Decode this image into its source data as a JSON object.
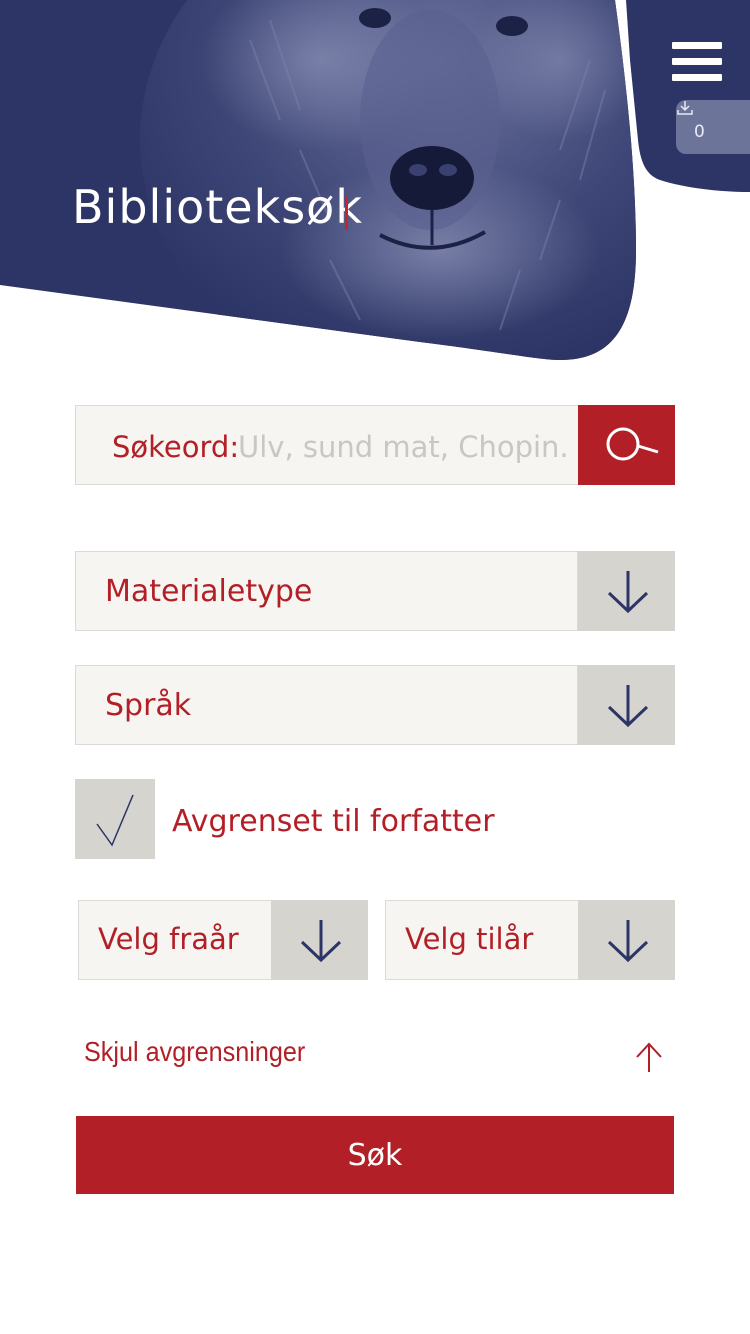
{
  "header": {
    "title": "Biblioteksøk",
    "menu_icon": "hamburger-menu-icon",
    "downloads": {
      "icon": "download-icon",
      "count": "0"
    }
  },
  "search": {
    "label": "Søkeord:",
    "placeholder": "Ulv, sund mat, Chopin...",
    "button_icon": "search-icon"
  },
  "filters": {
    "material_type": {
      "label": "Materialetype",
      "icon": "chevron-down-icon"
    },
    "language": {
      "label": "Språk",
      "icon": "chevron-down-icon"
    },
    "author_checkbox": {
      "label": "Avgrenset til forfatter",
      "checked": true,
      "icon": "checkmark-icon"
    },
    "year_from": {
      "label": "Velg fraår",
      "icon": "chevron-down-icon"
    },
    "year_to": {
      "label": "Velg tilår",
      "icon": "chevron-down-icon"
    }
  },
  "toggle": {
    "label": "Skjul avgrensninger",
    "icon": "arrow-up-icon"
  },
  "submit": {
    "label": "Søk"
  },
  "colors": {
    "brand_navy": "#2c3565",
    "accent_red": "#b31f26",
    "field_bg": "#f6f5f2",
    "arrow_bg": "#d6d4cf"
  }
}
